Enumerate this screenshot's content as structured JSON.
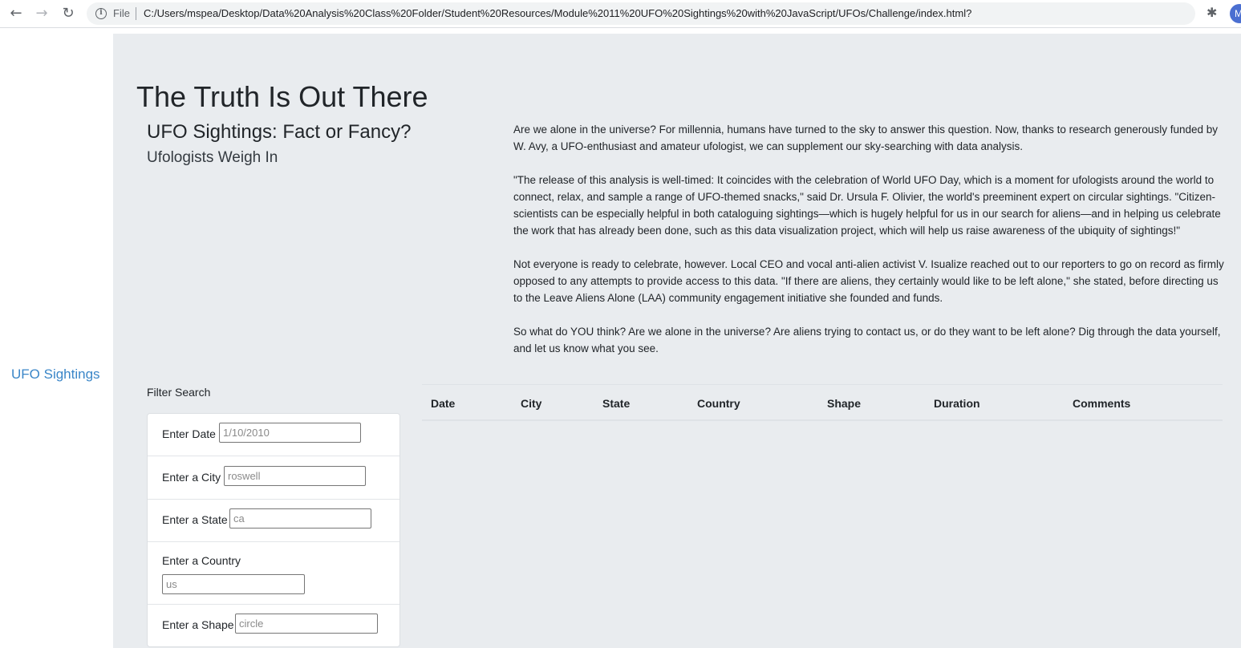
{
  "browser": {
    "scheme": "File",
    "url": "C:/Users/mspea/Desktop/Data%20Analysis%20Class%20Folder/Student%20Resources/Module%2011%20UFO%20Sightings%20with%20JavaScript/UFOs/Challenge/index.html?",
    "back": "←",
    "forward": "→",
    "reload": "↻",
    "info": "i",
    "star": "☆",
    "extensions": "✱",
    "profile_initial": "M"
  },
  "sidebar": {
    "link": "UFO Sightings"
  },
  "header": {
    "title": "The Truth Is Out There",
    "subtitle": "UFO Sightings: Fact or Fancy?",
    "tagline": "Ufologists Weigh In"
  },
  "article": {
    "paragraphs": [
      "Are we alone in the universe? For millennia, humans have turned to the sky to answer this question. Now, thanks to research generously funded by W. Avy, a UFO-enthusiast and amateur ufologist, we can supplement our sky-searching with data analysis.",
      "\"The release of this analysis is well-timed: It coincides with the celebration of World UFO Day, which is a moment for ufologists around the world to connect, relax, and sample a range of UFO-themed snacks,\" said Dr. Ursula F. Olivier, the world's preeminent expert on circular sightings. \"Citizen-scientists can be especially helpful in both cataloguing sightings—which is hugely helpful for us in our search for aliens—and in helping us celebrate the work that has already been done, such as this data visualization project, which will help us raise awareness of the ubiquity of sightings!\"",
      "Not everyone is ready to celebrate, however. Local CEO and vocal anti-alien activist V. Isualize reached out to our reporters to go on record as firmly opposed to any attempts to provide access to this data. \"If there are aliens, they certainly would like to be left alone,\" she stated, before directing us to the Leave Aliens Alone (LAA) community engagement initiative she founded and funds.",
      "So what do YOU think? Are we alone in the universe? Are aliens trying to contact us, or do they want to be left alone? Dig through the data yourself, and let us know what you see."
    ]
  },
  "filters": {
    "heading": "Filter Search",
    "date": {
      "label": "Enter Date",
      "placeholder": "1/10/2010",
      "value": ""
    },
    "city": {
      "label": "Enter a City",
      "placeholder": "roswell",
      "value": ""
    },
    "state": {
      "label": "Enter a State",
      "placeholder": "ca",
      "value": ""
    },
    "country": {
      "label": "Enter a Country",
      "placeholder": "us",
      "value": ""
    },
    "shape": {
      "label": "Enter a Shape",
      "placeholder": "circle",
      "value": ""
    }
  },
  "table": {
    "columns": [
      "Date",
      "City",
      "State",
      "Country",
      "Shape",
      "Duration",
      "Comments"
    ],
    "rows": []
  }
}
